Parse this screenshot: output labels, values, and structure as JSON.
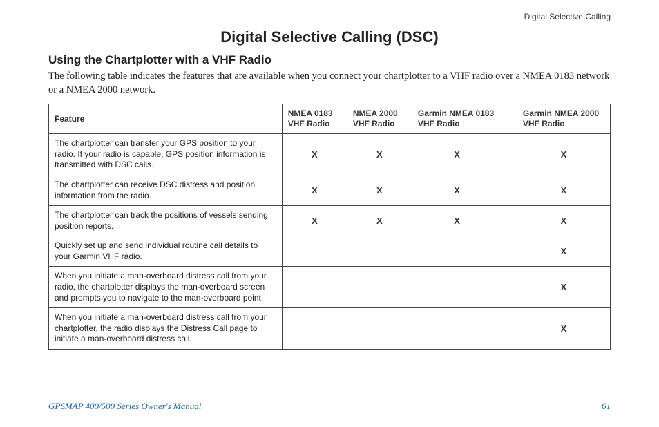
{
  "running_head": "Digital Selective Calling",
  "title": "Digital Selective Calling (DSC)",
  "subhead": "Using the Chartplotter with a VHF Radio",
  "intro": "The following table indicates the features that are available when you connect your chartplotter to a VHF radio over a NMEA 0183 network or a NMEA 2000 network.",
  "table": {
    "headers": {
      "feature": "Feature",
      "col1": "NMEA 0183 VHF Radio",
      "col2": "NMEA 2000 VHF Radio",
      "col3": "Garmin NMEA 0183 VHF Radio",
      "col4": "Garmin NMEA 2000 VHF Radio"
    },
    "rows": [
      {
        "feature": "The chartplotter can transfer your GPS position to your radio. If your radio is capable, GPS position information is transmitted with DSC calls.",
        "c1": "X",
        "c2": "X",
        "c3": "X",
        "c4": "X"
      },
      {
        "feature": "The chartplotter can receive DSC distress and position information from the radio.",
        "c1": "X",
        "c2": "X",
        "c3": "X",
        "c4": "X"
      },
      {
        "feature": "The chartplotter can track the positions of vessels sending position reports.",
        "c1": "X",
        "c2": "X",
        "c3": "X",
        "c4": "X"
      },
      {
        "feature": "Quickly set up and send individual routine call details to your Garmin VHF radio.",
        "c1": "",
        "c2": "",
        "c3": "",
        "c4": "X"
      },
      {
        "feature": "When you initiate a man-overboard distress call from your radio, the chartplotter displays the man-overboard screen and prompts you to navigate to the man-overboard point.",
        "c1": "",
        "c2": "",
        "c3": "",
        "c4": "X"
      },
      {
        "feature": "When you initiate a man-overboard distress call from your chartplotter, the radio displays the Distress Call page to initiate a man-overboard distress call.",
        "c1": "",
        "c2": "",
        "c3": "",
        "c4": "X"
      }
    ]
  },
  "footer": {
    "manual": "GPSMAP 400/500 Series Owner's Manual",
    "page": "61"
  }
}
